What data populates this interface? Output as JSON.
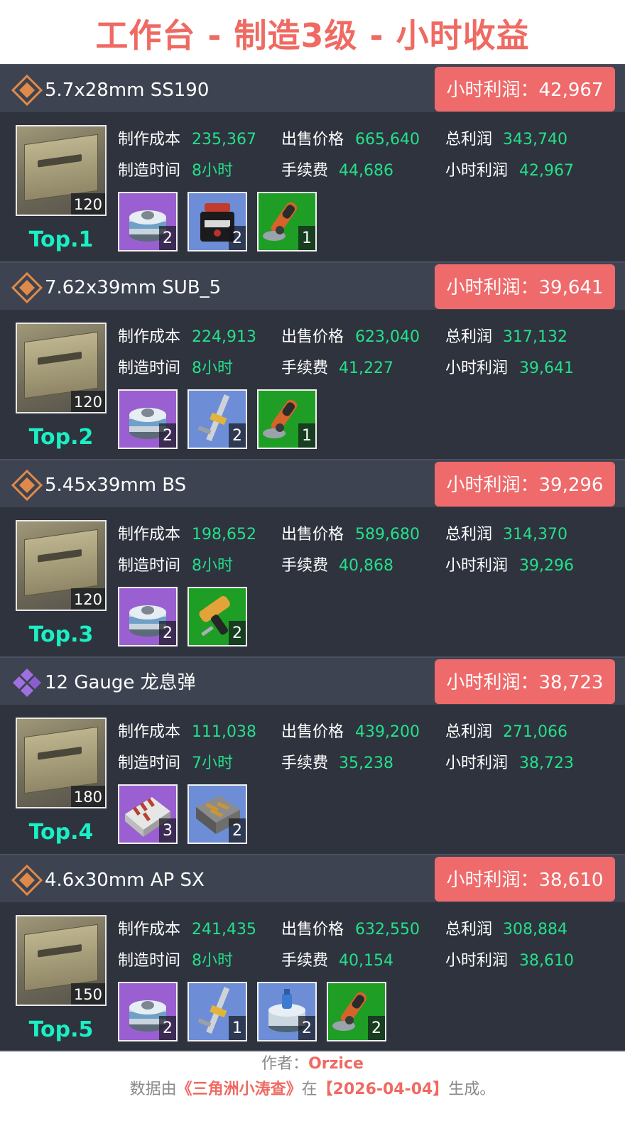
{
  "title": "工作台 - 制造3级 - 小时收益",
  "labels": {
    "cost": "制作成本",
    "sell_price": "出售价格",
    "total_profit": "总利润",
    "craft_time": "制造时间",
    "fee": "手续费",
    "hourly_profit": "小时利润"
  },
  "colors": {
    "title": "#ef6a62",
    "badge": "#ef6a6b",
    "value_green": "#23e08a",
    "rank_cyan": "#19f0c4",
    "card_bg": "#2f333e",
    "header_bg": "#3d4350",
    "rarity_gold": "#e08a4a",
    "rarity_purple": "#a070e0",
    "tier_purple": "#9a5fd0",
    "tier_blue": "#6d8ed6",
    "tier_green": "#1f9e25"
  },
  "items": [
    {
      "name": "5.7x28mm SS190",
      "rarity_icon": "gold-diamond-icon",
      "hourly_badge": "小时利润：42,967",
      "product_qty": "120",
      "rank": "Top.1",
      "cost": "235,367",
      "sell_price": "665,640",
      "total_profit": "343,740",
      "craft_time": "8小时",
      "fee": "44,686",
      "hourly_profit": "42,967",
      "materials": [
        {
          "icon": "fuel-canister-icon",
          "tier": "purple",
          "qty": "2"
        },
        {
          "icon": "powder-jar-icon",
          "tier": "blue",
          "qty": "2"
        },
        {
          "icon": "angle-grinder-icon",
          "tier": "green",
          "qty": "1"
        }
      ]
    },
    {
      "name": "7.62x39mm SUB_5",
      "rarity_icon": "gold-diamond-icon",
      "hourly_badge": "小时利润：39,641",
      "product_qty": "120",
      "rank": "Top.2",
      "cost": "224,913",
      "sell_price": "623,040",
      "total_profit": "317,132",
      "craft_time": "8小时",
      "fee": "41,227",
      "hourly_profit": "39,641",
      "materials": [
        {
          "icon": "fuel-canister-icon",
          "tier": "purple",
          "qty": "2"
        },
        {
          "icon": "caliper-icon",
          "tier": "blue",
          "qty": "2"
        },
        {
          "icon": "angle-grinder-icon",
          "tier": "green",
          "qty": "1"
        }
      ]
    },
    {
      "name": "5.45x39mm BS",
      "rarity_icon": "gold-diamond-icon",
      "hourly_badge": "小时利润：39,296",
      "product_qty": "120",
      "rank": "Top.3",
      "cost": "198,652",
      "sell_price": "589,680",
      "total_profit": "314,370",
      "craft_time": "8小时",
      "fee": "40,868",
      "hourly_profit": "39,296",
      "materials": [
        {
          "icon": "fuel-canister-icon",
          "tier": "purple",
          "qty": "2"
        },
        {
          "icon": "power-drill-icon",
          "tier": "green",
          "qty": "2"
        }
      ]
    },
    {
      "name": "12 Gauge 龙息弹",
      "rarity_icon": "purple-diamond-icon",
      "hourly_badge": "小时利润：38,723",
      "product_qty": "180",
      "rank": "Top.4",
      "cost": "111,038",
      "sell_price": "439,200",
      "total_profit": "271,066",
      "craft_time": "7小时",
      "fee": "35,238",
      "hourly_profit": "38,723",
      "materials": [
        {
          "icon": "ammo-tray-icon",
          "tier": "purple",
          "qty": "3"
        },
        {
          "icon": "ammo-box-icon",
          "tier": "blue",
          "qty": "2"
        }
      ]
    },
    {
      "name": "4.6x30mm AP SX",
      "rarity_icon": "gold-diamond-icon",
      "hourly_badge": "小时利润：38,610",
      "product_qty": "150",
      "rank": "Top.5",
      "cost": "241,435",
      "sell_price": "632,550",
      "total_profit": "308,884",
      "craft_time": "8小时",
      "fee": "40,154",
      "hourly_profit": "38,610",
      "materials": [
        {
          "icon": "fuel-canister-icon",
          "tier": "purple",
          "qty": "2"
        },
        {
          "icon": "caliper-icon",
          "tier": "blue",
          "qty": "1"
        },
        {
          "icon": "gas-canister-icon",
          "tier": "blue",
          "qty": "2"
        },
        {
          "icon": "angle-grinder-icon",
          "tier": "green",
          "qty": "2"
        }
      ]
    }
  ],
  "footer": {
    "author_label": "作者：",
    "author_name": "Orzice",
    "source_prefix": "数据由",
    "source_name": "《三角洲小涛查》",
    "source_mid": "在",
    "date": "【2026-04-04】",
    "source_suffix": "生成。"
  }
}
